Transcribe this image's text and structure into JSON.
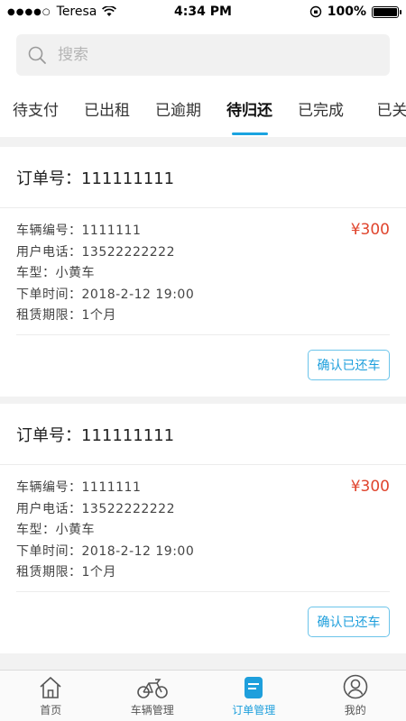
{
  "status_bar": {
    "carrier": "Teresa",
    "time": "4:34 PM",
    "battery": "100%"
  },
  "search": {
    "placeholder": "搜索"
  },
  "tabs": [
    {
      "label": "待支付"
    },
    {
      "label": "已出租"
    },
    {
      "label": "已逾期"
    },
    {
      "label": "待归还",
      "active": true
    },
    {
      "label": "已完成"
    },
    {
      "label": "已关"
    }
  ],
  "orders": [
    {
      "title": "订单号：111111111",
      "vehicle_no": "车辆编号：1111111",
      "phone": "用户电话：13522222222",
      "model": "车型：小黄车",
      "order_time": "下单时间：2018-2-12  19:00",
      "lease_term": "租赁期限：1个月",
      "price": "¥300",
      "action_label": "确认已还车"
    },
    {
      "title": "订单号：111111111",
      "vehicle_no": "车辆编号：1111111",
      "phone": "用户电话：13522222222",
      "model": "车型：小黄车",
      "order_time": "下单时间：2018-2-12  19:00",
      "lease_term": "租赁期限：1个月",
      "price": "¥300",
      "action_label": "确认已还车"
    }
  ],
  "tab_bar": [
    {
      "label": "首页",
      "icon": "home-icon"
    },
    {
      "label": "车辆管理",
      "icon": "bike-icon"
    },
    {
      "label": "订单管理",
      "icon": "order-icon",
      "active": true
    },
    {
      "label": "我的",
      "icon": "user-icon"
    }
  ],
  "colors": {
    "accent": "#1e9fdc",
    "price": "#e0452e",
    "background": "#f2f2f2"
  }
}
